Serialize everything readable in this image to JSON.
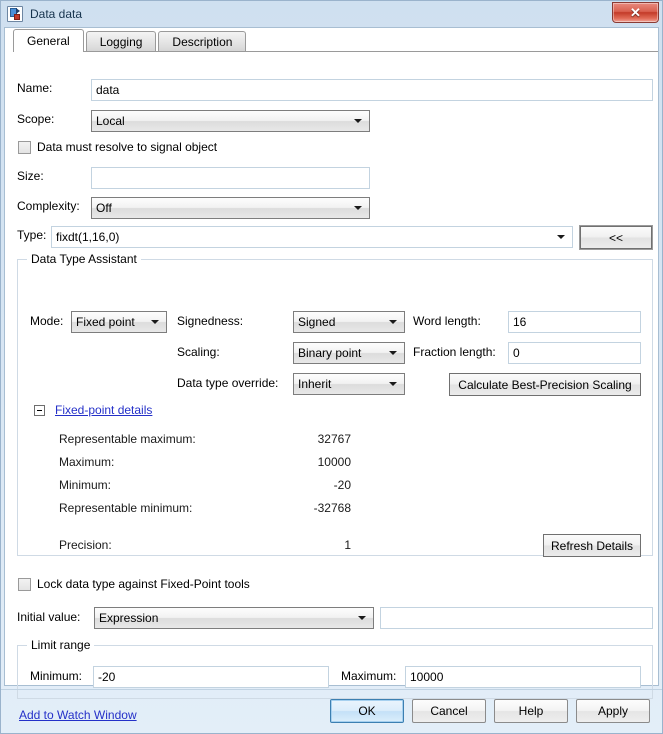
{
  "window": {
    "title": "Data data",
    "icon": "data-object-icon",
    "close_label": "✕"
  },
  "tabs": [
    {
      "label": "General",
      "active": true
    },
    {
      "label": "Logging",
      "active": false
    },
    {
      "label": "Description",
      "active": false
    }
  ],
  "general": {
    "name_label": "Name:",
    "name_value": "data",
    "scope_label": "Scope:",
    "scope_value": "Local",
    "resolve_checkbox_label": "Data must resolve to signal object",
    "resolve_checked": false,
    "size_label": "Size:",
    "size_value": "",
    "complexity_label": "Complexity:",
    "complexity_value": "Off",
    "type_label": "Type:",
    "type_value": "fixdt(1,16,0)",
    "collapse_button_label": "<<"
  },
  "data_type_assistant": {
    "title": "Data Type Assistant",
    "mode_label": "Mode:",
    "mode_value": "Fixed point",
    "signedness_label": "Signedness:",
    "signedness_value": "Signed",
    "word_length_label": "Word length:",
    "word_length_value": "16",
    "scaling_label": "Scaling:",
    "scaling_value": "Binary point",
    "fraction_length_label": "Fraction length:",
    "fraction_length_value": "0",
    "data_type_override_label": "Data type override:",
    "data_type_override_value": "Inherit",
    "calculate_button_label": "Calculate Best-Precision Scaling",
    "details_link_label": "Fixed-point details",
    "details": [
      {
        "label": "Representable maximum:",
        "value": "32767"
      },
      {
        "label": "Maximum:",
        "value": "10000"
      },
      {
        "label": "Minimum:",
        "value": "-20"
      },
      {
        "label": "Representable minimum:",
        "value": "-32768"
      }
    ],
    "precision_label": "Precision:",
    "precision_value": "1",
    "refresh_button_label": "Refresh Details"
  },
  "lock": {
    "label": "Lock data type against Fixed-Point tools",
    "checked": false
  },
  "initial_value": {
    "label": "Initial value:",
    "mode_value": "Expression",
    "expression_value": ""
  },
  "limit_range": {
    "title": "Limit range",
    "minimum_label": "Minimum:",
    "minimum_value": "-20",
    "maximum_label": "Maximum:",
    "maximum_value": "10000"
  },
  "watch_link_label": "Add to Watch Window",
  "dialog_buttons": {
    "ok": "OK",
    "cancel": "Cancel",
    "help": "Help",
    "apply": "Apply"
  }
}
